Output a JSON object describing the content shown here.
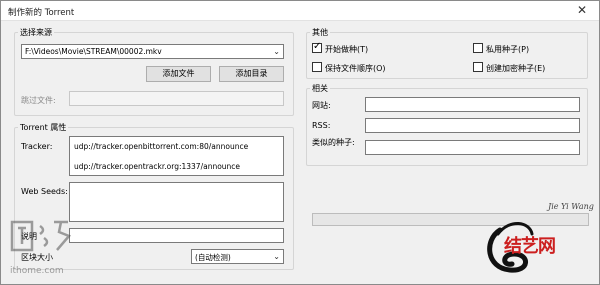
{
  "window": {
    "title": "制作新的 Torrent",
    "close_glyph": "✕"
  },
  "source": {
    "legend": "选择来源",
    "path_value": "F:\\Videos\\Movie\\STREAM\\00002.mkv",
    "add_file_label": "添加文件",
    "add_dir_label": "添加目录",
    "skip_files_label": "跳过文件:",
    "skip_files_value": ""
  },
  "torrent_props": {
    "legend": "Torrent 属性",
    "tracker_label": "Tracker:",
    "trackers": [
      "udp://tracker.openbittorrent.com:80/announce",
      "udp://tracker.opentrackr.org:1337/announce"
    ],
    "web_seeds_label": "Web Seeds:",
    "web_seeds_value": "",
    "comment_label": "说明",
    "comment_value": "",
    "piece_size_label": "区块大小",
    "piece_size_value": "(自动检测)"
  },
  "other": {
    "legend": "其他",
    "options": [
      {
        "label": "开始做种(T)",
        "checked": true
      },
      {
        "label": "私用种子(P)",
        "checked": false
      },
      {
        "label": "保持文件顺序(O)",
        "checked": false
      },
      {
        "label": "创建加密种子(E)",
        "checked": false
      }
    ]
  },
  "related": {
    "legend": "相关",
    "website_label": "网站:",
    "website_value": "",
    "rss_label": "RSS:",
    "rss_value": "",
    "similar_label": "类似的种子:",
    "similar_value": ""
  },
  "progress": {
    "value": 0
  },
  "watermarks": {
    "left_text": "ithome.com",
    "right_pinyin": "Jie Yi Wang",
    "right_text": "结艺网"
  },
  "colors": {
    "window_bg": "#f0f0f0",
    "watermark_red": "#cc1f1f"
  }
}
